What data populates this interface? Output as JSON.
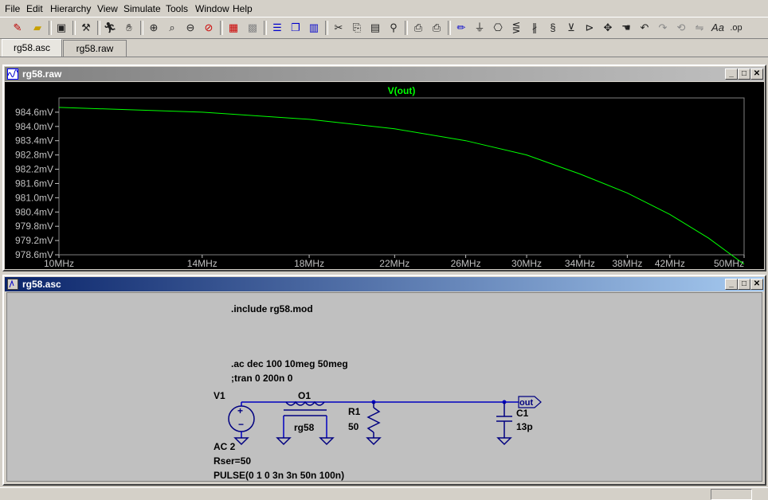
{
  "menu": {
    "file": "File",
    "edit": "Edit",
    "hierarchy": "Hierarchy",
    "view": "View",
    "simulate": "Simulate",
    "tools": "Tools",
    "window": "Window",
    "help": "Help"
  },
  "tabs": [
    {
      "label": "rg58.asc",
      "active": true
    },
    {
      "label": "rg58.raw",
      "active": false
    }
  ],
  "waveform_window": {
    "title": "rg58.raw",
    "trace_label": "V(out)",
    "trace_color": "#00ff00",
    "axis_text_color": "#c0c0c0"
  },
  "schematic_window": {
    "title": "rg58.asc",
    "directives": {
      "include": ".include rg58.mod",
      "ac": ".ac dec 100 10meg 50meg",
      "tran": ";tran 0 200n 0"
    },
    "components": {
      "v1_name": "V1",
      "v1_ac": "AC 2",
      "v1_rser": "Rser=50",
      "v1_pulse": "PULSE(0 1 0 3n 3n 50n 100n)",
      "o1_name": "O1",
      "o1_model": "rg58",
      "r1_name": "R1",
      "r1_value": "50",
      "c1_name": "C1",
      "c1_value": "13p",
      "net_label": "out"
    },
    "wire_color": "#0000c0",
    "text_color": "#000000"
  },
  "chart_data": {
    "type": "line",
    "title": "V(out)",
    "xlabel": "",
    "ylabel": "",
    "x_scale": "log",
    "xlim": [
      10,
      50
    ],
    "ylim": [
      978.6,
      985.2
    ],
    "x_ticks": [
      "10MHz",
      "14MHz",
      "18MHz",
      "22MHz",
      "26MHz",
      "30MHz",
      "34MHz",
      "38MHz",
      "42MHz",
      "50MHz"
    ],
    "x_tick_values": [
      10,
      14,
      18,
      22,
      26,
      30,
      34,
      38,
      42,
      50
    ],
    "y_ticks": [
      "984.6mV",
      "984.0mV",
      "983.4mV",
      "982.8mV",
      "982.2mV",
      "981.6mV",
      "981.0mV",
      "980.4mV",
      "979.8mV",
      "979.2mV",
      "978.6mV"
    ],
    "y_tick_values": [
      984.6,
      984.0,
      983.4,
      982.8,
      982.2,
      981.6,
      981.0,
      980.4,
      979.8,
      979.2,
      978.6
    ],
    "series": [
      {
        "name": "V(out)",
        "x": [
          10,
          14,
          18,
          22,
          26,
          30,
          34,
          38,
          42,
          46,
          50
        ],
        "y": [
          984.8,
          984.6,
          984.3,
          983.9,
          983.4,
          982.8,
          982.0,
          981.2,
          980.3,
          979.3,
          978.2
        ]
      }
    ]
  }
}
